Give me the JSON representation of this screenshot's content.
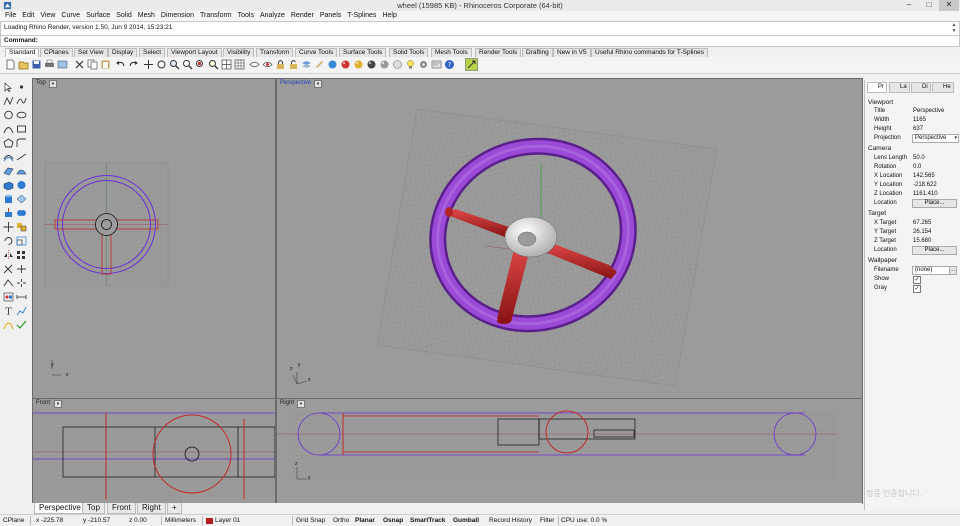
{
  "window": {
    "title": "wheel (15985 KB) - Rhinoceros Corporate (64-bit)",
    "minimize": "–",
    "maximize": "□",
    "close": "✕"
  },
  "menu": [
    "File",
    "Edit",
    "View",
    "Curve",
    "Surface",
    "Solid",
    "Mesh",
    "Dimension",
    "Transform",
    "Tools",
    "Analyze",
    "Render",
    "Panels",
    "T-Splines",
    "Help"
  ],
  "history": {
    "line": "Loading Rhino Render, version 1.50, Jun  9 2014, 15:23:21"
  },
  "command": {
    "prompt": "Command:"
  },
  "toolbar_tabs": [
    "Standard",
    "CPlanes",
    "Set View",
    "Display",
    "Select",
    "Viewport Layout",
    "Visibility",
    "Transform",
    "Curve Tools",
    "Surface Tools",
    "Solid Tools",
    "Mesh Tools",
    "Render Tools",
    "Drafting",
    "New in V5",
    "Useful Rhino commands for T-Splines"
  ],
  "viewports": {
    "top": {
      "title": "Top",
      "axis_x": "x",
      "axis_y": "y"
    },
    "perspective": {
      "title": "Perspective",
      "axis_x": "x",
      "axis_y": "y",
      "axis_z": "z"
    },
    "front": {
      "title": "Front",
      "axis_x": "x",
      "axis_y": "z"
    },
    "right": {
      "title": "Right",
      "axis_x": "y",
      "axis_y": "z"
    }
  },
  "viewport_tabs": [
    "Perspective",
    "Top",
    "Front",
    "Right",
    "+"
  ],
  "properties": {
    "tabs": [
      "Pr",
      "La",
      "Di",
      "He"
    ],
    "viewport_section": "Viewport",
    "title_label": "Title",
    "title_value": "Perspective",
    "width_label": "Width",
    "width_value": "1165",
    "height_label": "Height",
    "height_value": "637",
    "projection_label": "Projection",
    "projection_value": "Perspective",
    "camera_section": "Camera",
    "lens_label": "Lens Length",
    "lens_value": "50.0",
    "rotation_label": "Rotation",
    "rotation_value": "0.0",
    "xloc_label": "X Location",
    "xloc_value": "142.565",
    "yloc_label": "Y Location",
    "yloc_value": "-218.622",
    "zloc_label": "Z Location",
    "zloc_value": "1161.410",
    "location_label": "Location",
    "place_button": "Place...",
    "target_section": "Target",
    "xt_label": "X Target",
    "xt_value": "67.265",
    "yt_label": "Y Target",
    "yt_value": "26.154",
    "zt_label": "Z Target",
    "zt_value": "15.680",
    "tloc_label": "Location",
    "tplace_button": "Place...",
    "wallpaper_section": "Wallpaper",
    "filename_label": "Filename",
    "filename_value": "(none)",
    "show_label": "Show",
    "show_check": "✓",
    "gray_label": "Gray",
    "gray_check": "✓",
    "more_button": "..."
  },
  "status": {
    "cplane": "CPlane",
    "x": "x -225.78",
    "y": "y -210.57",
    "z": "z 0.00",
    "units": "Millimeters",
    "layer": "Layer 01",
    "layer_color": "#b41e1e",
    "grid_snap": "Grid Snap",
    "ortho": "Ortho",
    "planar": "Planar",
    "osnap": "Osnap",
    "smarttrack": "SmartTrack",
    "gumball": "Gumball",
    "record_history": "Record History",
    "filter": "Filter",
    "cpu": "CPU use: 0.0 %"
  },
  "watermark": "정품 인증합니다.",
  "colors": {
    "rim": "#8a3fc4",
    "spokes": "#c22a2a",
    "viewport_bg": "#9b9b9b",
    "active_title": "#1a3fb5"
  }
}
